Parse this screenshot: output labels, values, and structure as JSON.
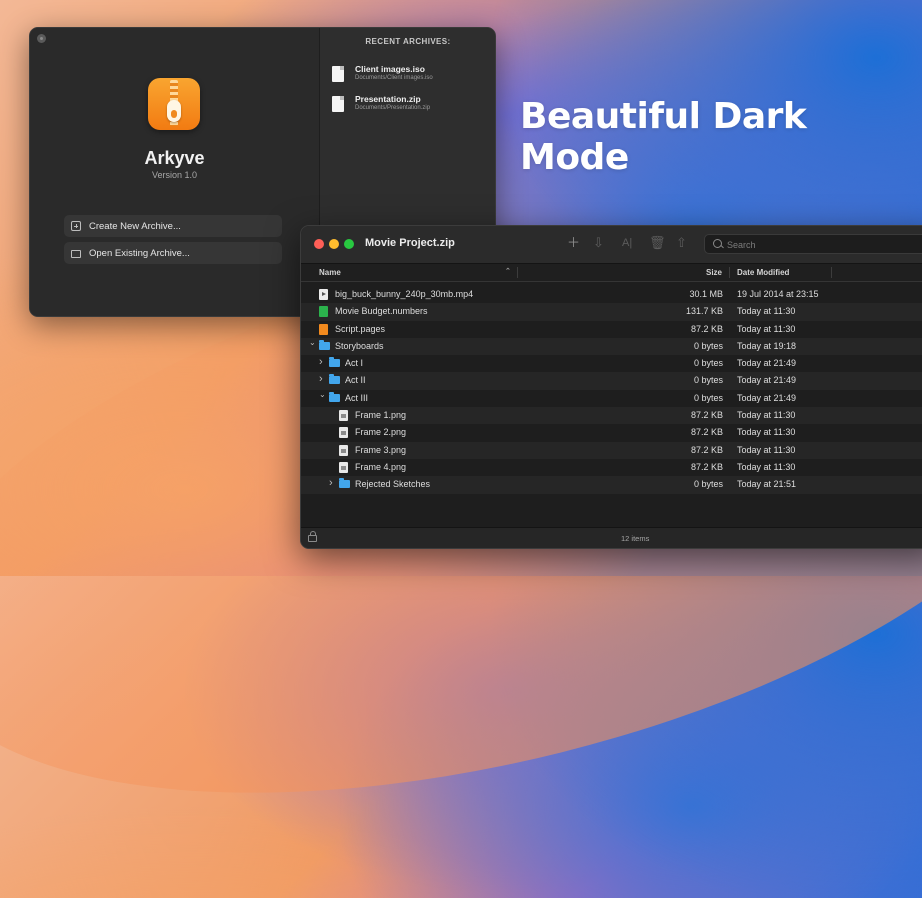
{
  "headline": "Beautiful Dark Mode",
  "welcome": {
    "app_name": "Arkyve",
    "version": "Version 1.0",
    "actions": [
      {
        "label": "Create New Archive...",
        "icon": "plus-square-icon"
      },
      {
        "label": "Open Existing Archive...",
        "icon": "folder-icon"
      }
    ],
    "recent_title": "RECENT ARCHIVES:",
    "recent": [
      {
        "name": "Client images.iso",
        "path": "Documents/Client images.iso"
      },
      {
        "name": "Presentation.zip",
        "path": "Documents/Presentation.zip"
      }
    ]
  },
  "main": {
    "title": "Movie Project.zip",
    "toolbar": [
      "add-icon",
      "extract-icon",
      "rename-icon",
      "trash-icon",
      "share-icon"
    ],
    "search_placeholder": "Search",
    "columns": {
      "name": "Name",
      "size": "Size",
      "date": "Date Modified"
    },
    "rows": [
      {
        "name": "big_buck_bunny_240p_30mb.mp4",
        "size": "30.1 MB",
        "date": "19 Jul 2014 at 23:15",
        "kind": "mp4",
        "indent": 0,
        "chevron": ""
      },
      {
        "name": "Movie Budget.numbers",
        "size": "131.7 KB",
        "date": "Today at 11:30",
        "kind": "numbers",
        "indent": 0,
        "chevron": ""
      },
      {
        "name": "Script.pages",
        "size": "87.2 KB",
        "date": "Today at 11:30",
        "kind": "pages",
        "indent": 0,
        "chevron": ""
      },
      {
        "name": "Storyboards",
        "size": "0 bytes",
        "date": "Today at 19:18",
        "kind": "folder",
        "indent": 0,
        "chevron": "down"
      },
      {
        "name": "Act I",
        "size": "0 bytes",
        "date": "Today at 21:49",
        "kind": "folder",
        "indent": 1,
        "chevron": "right"
      },
      {
        "name": "Act II",
        "size": "0 bytes",
        "date": "Today at 21:49",
        "kind": "folder",
        "indent": 1,
        "chevron": "right"
      },
      {
        "name": "Act III",
        "size": "0 bytes",
        "date": "Today at 21:49",
        "kind": "folder",
        "indent": 1,
        "chevron": "down"
      },
      {
        "name": "Frame 1.png",
        "size": "87.2 KB",
        "date": "Today at 11:30",
        "kind": "png",
        "indent": 2,
        "chevron": ""
      },
      {
        "name": "Frame 2.png",
        "size": "87.2 KB",
        "date": "Today at 11:30",
        "kind": "png",
        "indent": 2,
        "chevron": ""
      },
      {
        "name": "Frame 3.png",
        "size": "87.2 KB",
        "date": "Today at 11:30",
        "kind": "png",
        "indent": 2,
        "chevron": ""
      },
      {
        "name": "Frame 4.png",
        "size": "87.2 KB",
        "date": "Today at 11:30",
        "kind": "png",
        "indent": 2,
        "chevron": ""
      },
      {
        "name": "Rejected Sketches",
        "size": "0 bytes",
        "date": "Today at 21:51",
        "kind": "folder",
        "indent": 2,
        "chevron": "right"
      }
    ],
    "status": "12 items"
  },
  "colors": {
    "traffic_red": "#fe5f57",
    "traffic_yellow": "#febc2e",
    "traffic_green": "#28c840",
    "folder_blue": "#42a6ec",
    "app_orange": "#f58c1c"
  }
}
